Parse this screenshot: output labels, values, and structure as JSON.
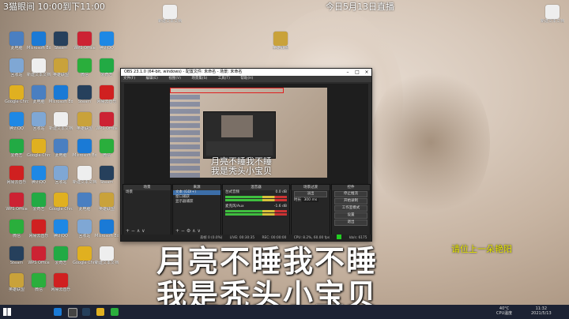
{
  "overlay": {
    "top_left": "3猫眼间 10:00到下11:00",
    "top_right": "今日5月13日直播"
  },
  "desktop_icons": [
    {
      "label": "此电脑",
      "color": "#4a7fc1"
    },
    {
      "label": "回收站",
      "color": "#7fa7d4"
    },
    {
      "label": "Google Chrome",
      "color": "#e0b020"
    },
    {
      "label": "腾讯QQ",
      "color": "#1e88e5"
    },
    {
      "label": "爱奇艺",
      "color": "#22aa44"
    },
    {
      "label": "网易云音乐",
      "color": "#d02020"
    },
    {
      "label": "WPS Office",
      "color": "#c23"
    },
    {
      "label": "微信",
      "color": "#2aae3c"
    },
    {
      "label": "Steam",
      "color": "#26405c"
    },
    {
      "label": "英雄联盟",
      "color": "#c9a23a"
    },
    {
      "label": "Microsoft Edge",
      "color": "#1a7ad6"
    },
    {
      "label": "新建文本文档",
      "color": "#eeeeee"
    }
  ],
  "obs": {
    "title": "OBS 23.1.0 (64-bit, windows) - 配置文件: 未命名 - 场景: 未命名",
    "menu": [
      "文件(F)",
      "编辑(E)",
      "视图(V)",
      "场景集(S)",
      "工具(T)",
      "帮助(H)"
    ],
    "docks": {
      "scenes": {
        "header": "场景",
        "items": [
          "场景"
        ]
      },
      "sources": {
        "header": "来源",
        "items": [
          "文本 (GDI+)",
          "窗口捕获",
          "显示器捕获"
        ]
      },
      "mixer": {
        "header": "混音器",
        "ch1": "台式音频",
        "ch2": "麦克风/Aux",
        "db1": "0.0 dB",
        "db2": "-1.6 dB"
      },
      "transitions": {
        "header": "场景过渡",
        "type": "淡出",
        "duration_label": "时长",
        "duration": "300 ms"
      },
      "controls": {
        "header": "控件",
        "buttons": [
          "停止推流",
          "开始录制",
          "工作室模式",
          "设置",
          "退出"
        ]
      }
    },
    "status": {
      "dropped": "丢帧 0 (0.0%)",
      "live": "LIVE: 00:30:35",
      "rec": "REC: 00:00:00",
      "cpu": "CPU: 8.2%, 60.00 fps",
      "kbps": "kb/s: 6175"
    }
  },
  "captions": {
    "line1": "月亮不睡我不睡",
    "line2": "我是秃头小宝贝"
  },
  "danmu": "请位上一朵艳阳",
  "taskbar": {
    "temp": "40°C",
    "cpu_label": "CPU温度",
    "time": "11:32",
    "date": "2021/5/13"
  }
}
